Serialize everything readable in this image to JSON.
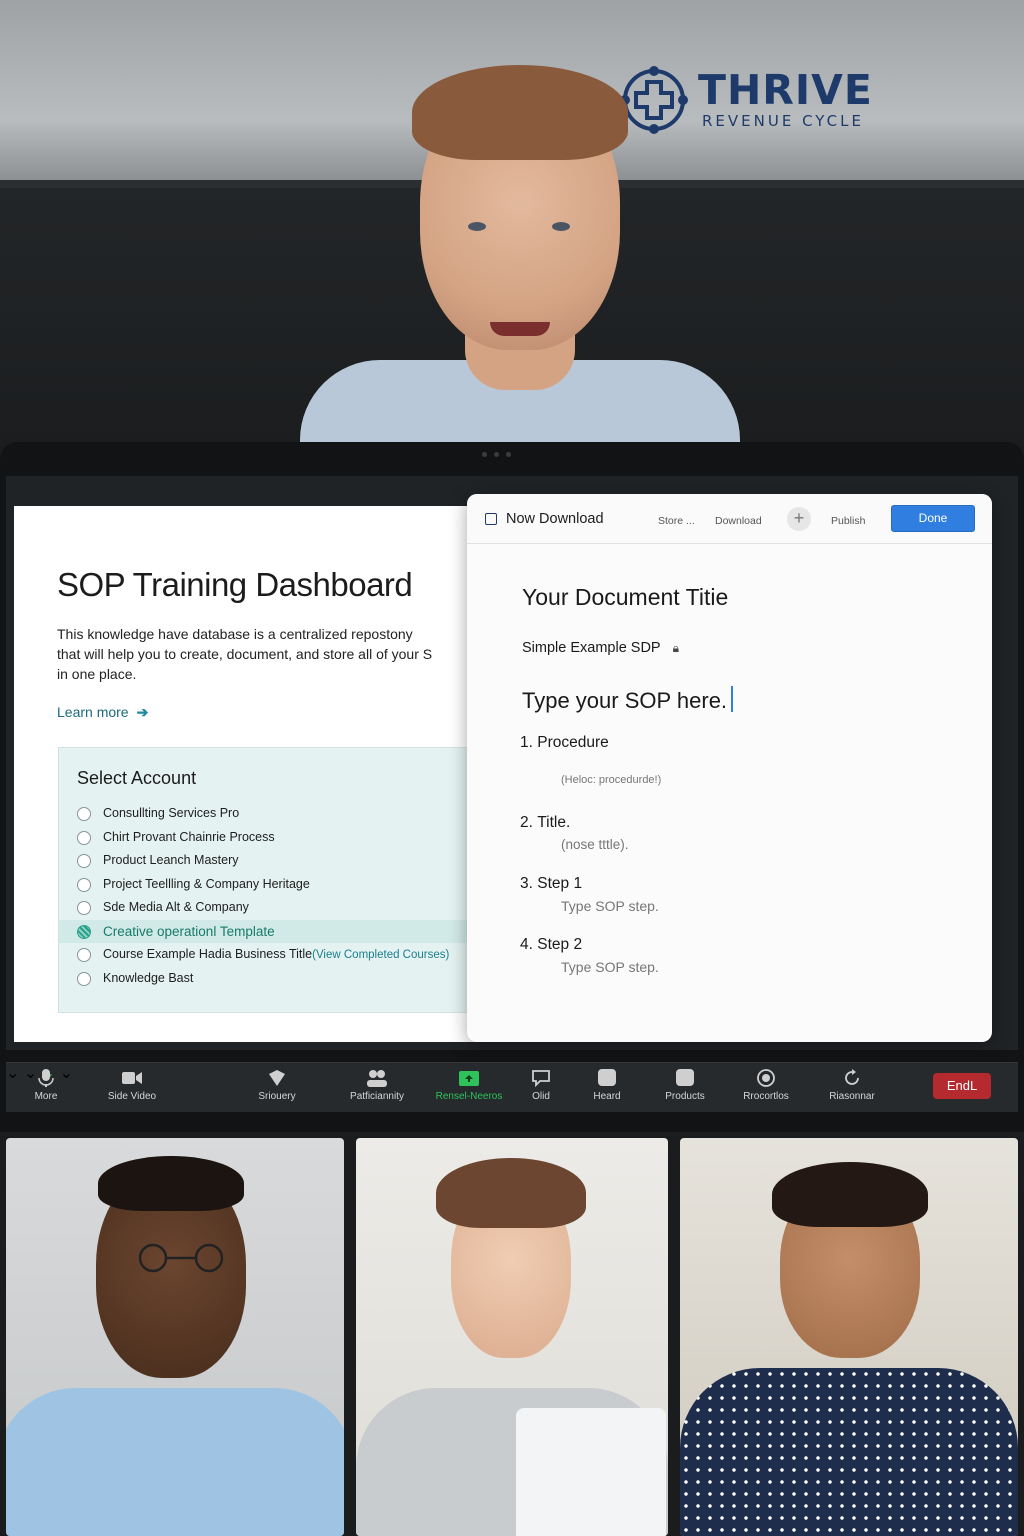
{
  "brand": {
    "name": "THRIVE",
    "tagline": "REVENUE CYCLE",
    "color": "#1d3a6b"
  },
  "dashboard": {
    "title": "SOP Training Dashboard",
    "description": "This knowledge have database is a centralized repostony\nthat will help you to create, document, and store all of your S\nin one place.",
    "learn_more": "Learn more",
    "account_heading": "Select Account",
    "accounts": [
      {
        "label": "Consullting Services Pro",
        "selected": false
      },
      {
        "label": "Chirt Provant Chainrie Process",
        "selected": false
      },
      {
        "label": "Product Leanch Mastery",
        "selected": false
      },
      {
        "label": "Project Teellling & Company Heritage",
        "selected": false
      },
      {
        "label": "Sde Media Alt & Company",
        "selected": false
      },
      {
        "label": "Creative operationl Template",
        "selected": true
      },
      {
        "label": "Course Example Hadia Business Title",
        "link": "(View Completed Courses)",
        "selected": false
      },
      {
        "label": "Knowledge Bast",
        "selected": false
      }
    ],
    "accent": "#1a6b7a"
  },
  "editor": {
    "window_title": "Now Download",
    "toolbar": {
      "store": "Store ...",
      "download": "Download",
      "add": "+",
      "publish": "Publish",
      "done": "Done"
    },
    "doc_title": "Your Document Titie",
    "subtitle": "Simple Example SDP",
    "placeholder": "Type your SOP here.",
    "steps": [
      {
        "num": "1.",
        "label": "Procedure",
        "hint": "(Heloc: procedurde!)"
      },
      {
        "num": "2.",
        "label": "Title.",
        "hint": "(nose tttle)."
      },
      {
        "num": "3.",
        "label": "Step 1",
        "hint": "Type SOP step."
      },
      {
        "num": "4.",
        "label": "Step 2",
        "hint": "Type SOP step."
      }
    ],
    "done_color": "#2f7ee0"
  },
  "toolbar": {
    "items": [
      {
        "label": "More",
        "icon": "microphone-icon"
      },
      {
        "label": "Side Video",
        "icon": "video-camera-icon"
      },
      {
        "label": "Sriouery",
        "icon": "shield-icon"
      },
      {
        "label": "Patficiannity",
        "icon": "participants-icon"
      },
      {
        "label": "Rensel-Neeros",
        "icon": "share-screen-icon",
        "active": true
      },
      {
        "label": "Olid",
        "icon": "chat-bubble-icon"
      },
      {
        "label": "Heard",
        "icon": "square-icon"
      },
      {
        "label": "Products",
        "icon": "square-icon"
      },
      {
        "label": "Rrocortlos",
        "icon": "record-icon"
      },
      {
        "label": "Riasonnar",
        "icon": "refresh-icon"
      }
    ],
    "end_label": "EndL",
    "end_color": "#b52a2e"
  }
}
